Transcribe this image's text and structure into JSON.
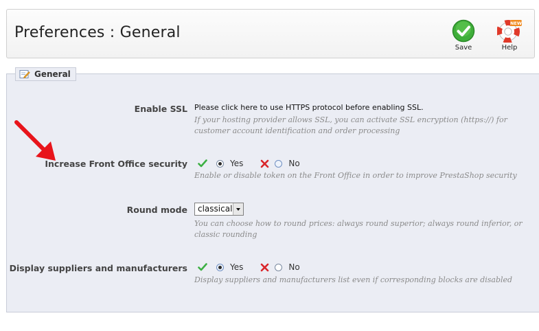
{
  "header": {
    "title": "Preferences : General",
    "save_label": "Save",
    "help_label": "Help",
    "help_badge": "NEW"
  },
  "fieldset": {
    "legend": "General"
  },
  "fields": {
    "ssl": {
      "label": "Enable SSL",
      "link_text": "Please click here to use HTTPS protocol before enabling SSL.",
      "hint": "If your hosting provider allows SSL, you can activate SSL encryption (https://) for customer account identification and order processing"
    },
    "security": {
      "label": "Increase Front Office security",
      "yes": "Yes",
      "no": "No",
      "selected": "Yes",
      "hint": "Enable or disable token on the Front Office in order to improve PrestaShop security"
    },
    "round": {
      "label": "Round mode",
      "value": "classical",
      "hint": "You can choose how to round prices: always round superior; always round inferior, or classic rounding"
    },
    "suppliers": {
      "label": "Display suppliers and manufacturers",
      "yes": "Yes",
      "no": "No",
      "selected": "Yes",
      "hint": "Display suppliers and manufacturers list even if corresponding blocks are disabled"
    }
  },
  "colors": {
    "accent_arrow": "#e8141b",
    "check_green": "#3cb043",
    "cross_red": "#d9262b",
    "panel_bg": "#ebedf4"
  },
  "icons": {
    "save": "check-circle-icon",
    "help": "lifebuoy-icon",
    "legend": "edit-note-icon",
    "annotation": "red-arrow-icon"
  }
}
